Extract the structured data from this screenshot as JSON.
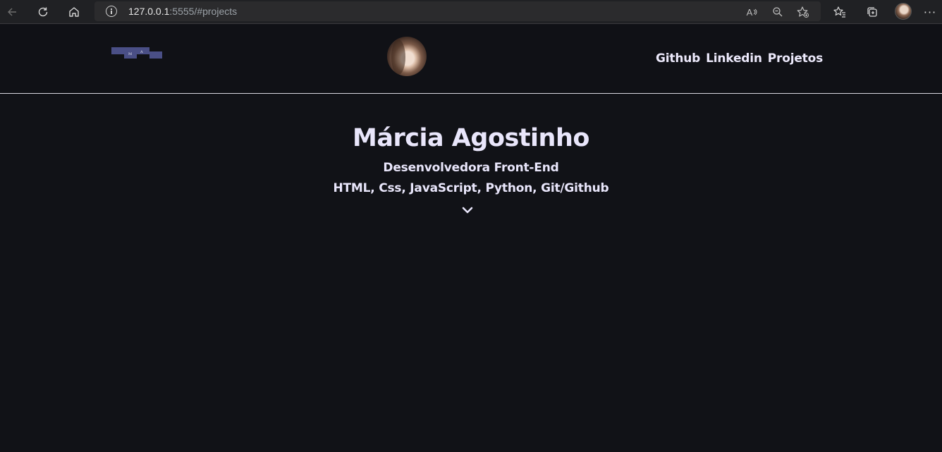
{
  "browser": {
    "url_host": "127.0.0.1",
    "url_rest": ":5555/#projects",
    "read_aloud_label": "A",
    "icons": [
      "back-icon",
      "reload-icon",
      "home-icon",
      "info-icon",
      "read-aloud-icon",
      "zoom-out-icon",
      "add-favorite-icon",
      "favorites-icon",
      "collections-icon",
      "profile-icon",
      "more-icon"
    ]
  },
  "header": {
    "logo_letters": [
      "M",
      "A"
    ],
    "nav": [
      "Github",
      "Linkedin",
      "Projetos"
    ]
  },
  "hero": {
    "name": "Márcia Agostinho",
    "role": "Desenvolvedora Front-End",
    "skills": "HTML, Css, JavaScript, Python, Git/Github"
  },
  "colors": {
    "background": "#111217",
    "text": "#e9e6fb",
    "logo": "#4a4f86",
    "chrome": "#202124"
  }
}
